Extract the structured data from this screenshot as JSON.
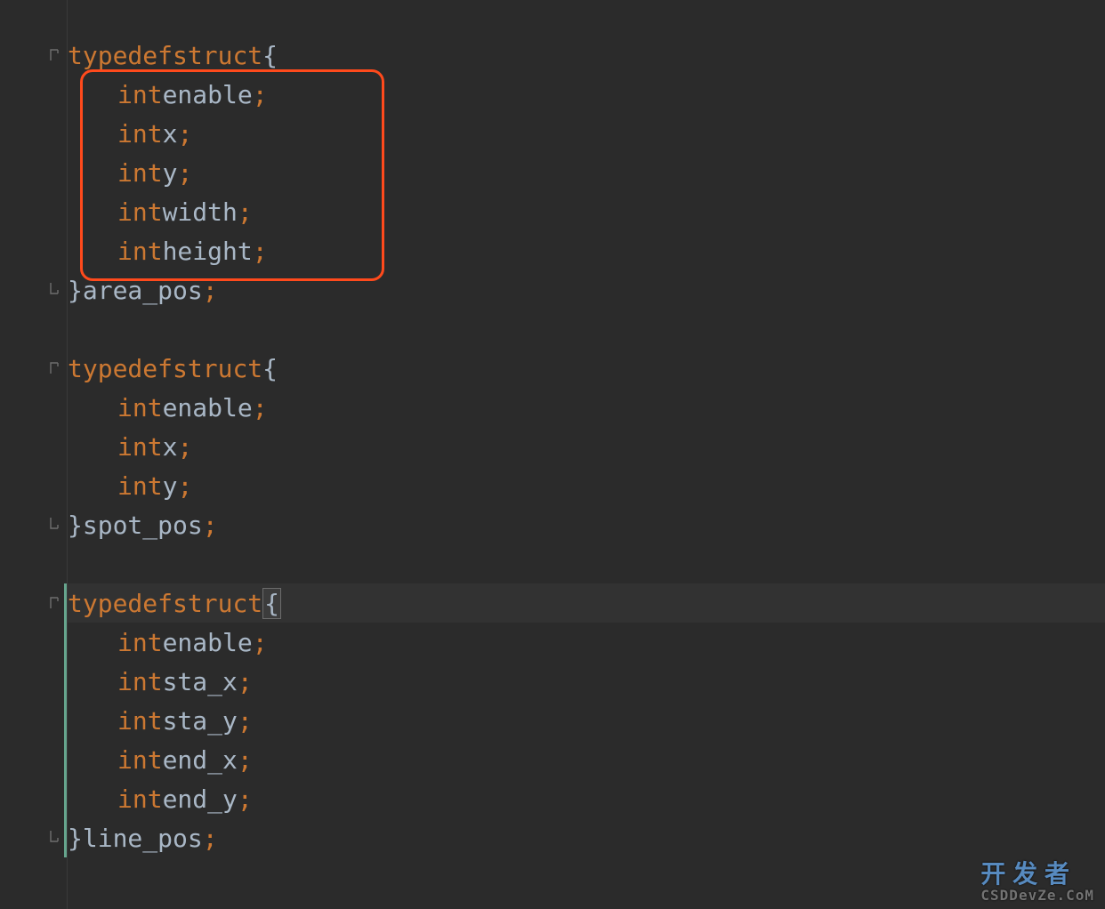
{
  "keywords": {
    "typedef": "typedef",
    "struct": "struct",
    "int": "int"
  },
  "lines": [
    {
      "kind": "struct_open",
      "fold": "open_down"
    },
    {
      "kind": "field",
      "name": "enable",
      "highlighted": true
    },
    {
      "kind": "field",
      "name": "x",
      "highlighted": true
    },
    {
      "kind": "field",
      "name": "y",
      "highlighted": true
    },
    {
      "kind": "field",
      "name": "width",
      "highlighted": true
    },
    {
      "kind": "field",
      "name": "height",
      "highlighted": true
    },
    {
      "kind": "struct_close",
      "name": "area_pos",
      "fold": "close_up"
    },
    {
      "kind": "blank"
    },
    {
      "kind": "struct_open",
      "fold": "open_down"
    },
    {
      "kind": "field",
      "name": "enable"
    },
    {
      "kind": "field",
      "name": "x"
    },
    {
      "kind": "field",
      "name": "y"
    },
    {
      "kind": "struct_close",
      "name": "spot_pos",
      "fold": "close_up"
    },
    {
      "kind": "blank"
    },
    {
      "kind": "struct_open",
      "fold": "open_down",
      "current": true,
      "bracket_match": true,
      "modified": true
    },
    {
      "kind": "field",
      "name": "enable",
      "modified": true
    },
    {
      "kind": "field",
      "name": "sta_x",
      "modified": true
    },
    {
      "kind": "field",
      "name": "sta_y",
      "modified": true
    },
    {
      "kind": "field",
      "name": "end_x",
      "modified": true
    },
    {
      "kind": "field",
      "name": "end_y",
      "modified": true
    },
    {
      "kind": "struct_close",
      "name": "line_pos",
      "fold": "close_up",
      "modified": true
    }
  ],
  "highlight_box": {
    "top_line": 1,
    "bottom_line": 5
  },
  "watermark": {
    "main": "开 发 者",
    "sub": "CSDDevZe.CoM"
  }
}
